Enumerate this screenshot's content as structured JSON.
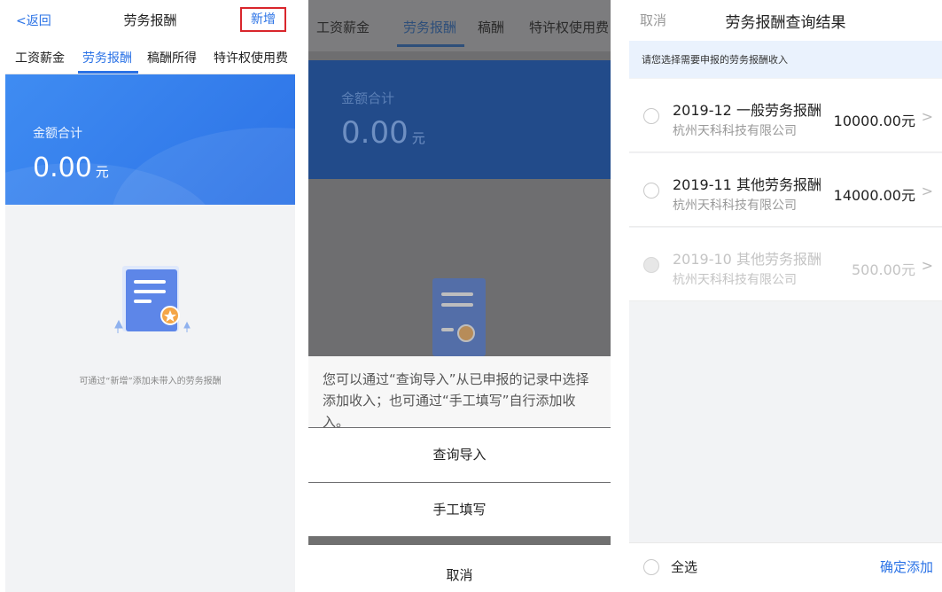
{
  "screen1": {
    "back_label": "返回",
    "title": "劳务报酬",
    "add_button": "新增",
    "tabs": [
      "工资薪金",
      "劳务报酬",
      "稿酬所得",
      "特许权使用费"
    ],
    "active_tab": "劳务报酬",
    "amount_label": "金额合计",
    "amount": "0.00",
    "unit": "元",
    "empty_hint": "可通过“新增”添加未带入的劳务报酬",
    "colors": {
      "accent": "#2a72e6",
      "highlight_border": "#d9262c"
    }
  },
  "screen2": {
    "tabs": [
      "工资薪金",
      "劳务报酬",
      "稿酬",
      "特许权使用费"
    ],
    "active_tab": "劳务报酬",
    "amount_label": "金额合计",
    "amount": "0.00",
    "unit": "元",
    "sheet_message": "您可以通过“查询导入”从已申报的记录中选择添加收入；也可通过“手工填写”自行添加收入。",
    "options": [
      "查询导入",
      "手工填写"
    ],
    "cancel": "取消"
  },
  "screen3": {
    "cancel": "取消",
    "title": "劳务报酬查询结果",
    "tip": "请您选择需要申报的劳务报酬收入",
    "items": [
      {
        "name": "2019-12 一般劳务报酬",
        "company": "杭州天科科技有限公司",
        "amount": "10000.00元",
        "disabled": false
      },
      {
        "name": "2019-11 其他劳务报酬",
        "company": "杭州天科科技有限公司",
        "amount": "14000.00元",
        "disabled": false
      },
      {
        "name": "2019-10 其他劳务报酬",
        "company": "杭州天科科技有限公司",
        "amount": "500.00元",
        "disabled": true
      }
    ],
    "select_all": "全选",
    "confirm": "确定添加"
  }
}
